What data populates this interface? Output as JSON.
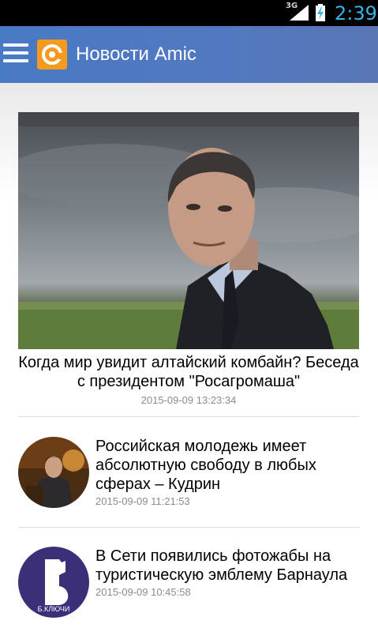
{
  "status_bar": {
    "network": "3G",
    "time": "2:39",
    "icons": [
      "signal-icon",
      "battery-charging-icon"
    ]
  },
  "action_bar": {
    "title": "Новости Amic",
    "icons": [
      "menu-icon",
      "app-logo-icon"
    ]
  },
  "featured": {
    "title": "Когда мир увидит алтайский комбайн? Беседа с президентом \"Росагромаша\"",
    "timestamp": "2015-09-09 13:23:34"
  },
  "news": [
    {
      "title": "Российская молодежь имеет абсолютную свободу в любых сферах – Кудрин",
      "timestamp": "2015-09-09 11:21:53"
    },
    {
      "title": "В Сети появились фотожабы на туристическую эмблему Барнаула",
      "timestamp": "2015-09-09 10:45:58",
      "thumb_caption": "Б.КЛЮЧИ"
    }
  ],
  "colors": {
    "action_bar": "#4f79c1",
    "logo": "#f39a1f",
    "clock": "#33b5e5",
    "timestamp": "#8c8c8c"
  }
}
